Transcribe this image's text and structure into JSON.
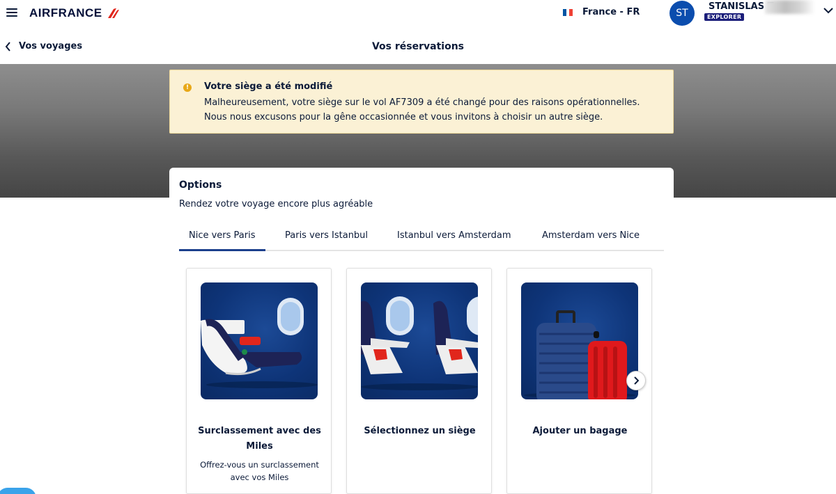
{
  "header": {
    "logo_text": "AIRFRANCE",
    "locale_label": "France - FR",
    "user_initials": "ST",
    "user_name": "STANISLAS T",
    "user_tier": "EXPLORER",
    "colors": {
      "brand_navy": "#051039",
      "brand_red": "#e1261c",
      "avatar_blue": "#0b4dae",
      "tier_badge": "#1b1e7a"
    },
    "icons": [
      "menu-icon",
      "france-flag-icon",
      "chevron-down-icon"
    ]
  },
  "subheader": {
    "back_label": "Vos voyages",
    "page_title": "Vos réservations",
    "icons": [
      "chevron-left-icon"
    ]
  },
  "alert": {
    "title": "Votre siège a été modifié",
    "body": "Malheureusement, votre siège sur le vol AF7309 a été changé pour des raisons opérationnelles. Nous nous excusons pour la gêne occasionnée et vous invitons à choisir un autre siège.",
    "icon": "warning-icon",
    "colors": {
      "background": "#fbf1d5",
      "icon": "#e8a818"
    }
  },
  "options": {
    "title": "Options",
    "subtitle": "Rendez votre voyage encore plus agréable",
    "tabs": [
      {
        "label": "Nice vers Paris",
        "active": true
      },
      {
        "label": "Paris vers Istanbul",
        "active": false
      },
      {
        "label": "Istanbul vers Amsterdam",
        "active": false
      },
      {
        "label": "Amsterdam vers Nice",
        "active": false
      }
    ],
    "cards": [
      {
        "title": "Surclassement avec des Miles",
        "description": "Offrez-vous un surclassement avec vos Miles",
        "image": "business-seat-image"
      },
      {
        "title": "Sélectionnez un siège",
        "description": "",
        "image": "economy-seats-image"
      },
      {
        "title": "Ajouter un bagage",
        "description": "",
        "image": "luggage-image"
      }
    ],
    "colors": {
      "tab_active_underline": "#1b3f8c"
    }
  }
}
